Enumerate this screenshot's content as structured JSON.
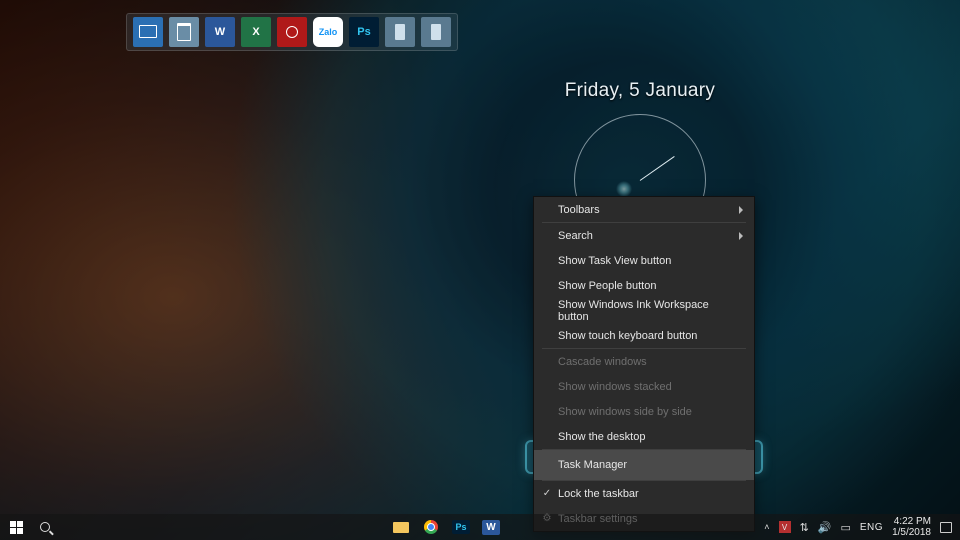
{
  "widget": {
    "date": "Friday, 5 January"
  },
  "shelf": {
    "items": [
      {
        "name": "monitor"
      },
      {
        "name": "trash"
      },
      {
        "name": "word",
        "label": "W"
      },
      {
        "name": "excel",
        "label": "X"
      },
      {
        "name": "garena"
      },
      {
        "name": "zalo",
        "label": "Zalo"
      },
      {
        "name": "ps",
        "label": "Ps"
      },
      {
        "name": "blank1"
      },
      {
        "name": "blank2"
      }
    ]
  },
  "context_menu": {
    "toolbars": "Toolbars",
    "search": "Search",
    "show_task_view": "Show Task View button",
    "show_people": "Show People button",
    "show_ink": "Show Windows Ink Workspace button",
    "show_touch_kb": "Show touch keyboard button",
    "cascade": "Cascade windows",
    "stacked": "Show windows stacked",
    "sidebyside": "Show windows side by side",
    "show_desktop": "Show the desktop",
    "task_manager": "Task Manager",
    "lock_taskbar": "Lock the taskbar",
    "taskbar_settings": "Taskbar settings"
  },
  "tray": {
    "lang": "ENG",
    "time": "4:22 PM",
    "date": "1/5/2018",
    "shield_letter": "V"
  }
}
